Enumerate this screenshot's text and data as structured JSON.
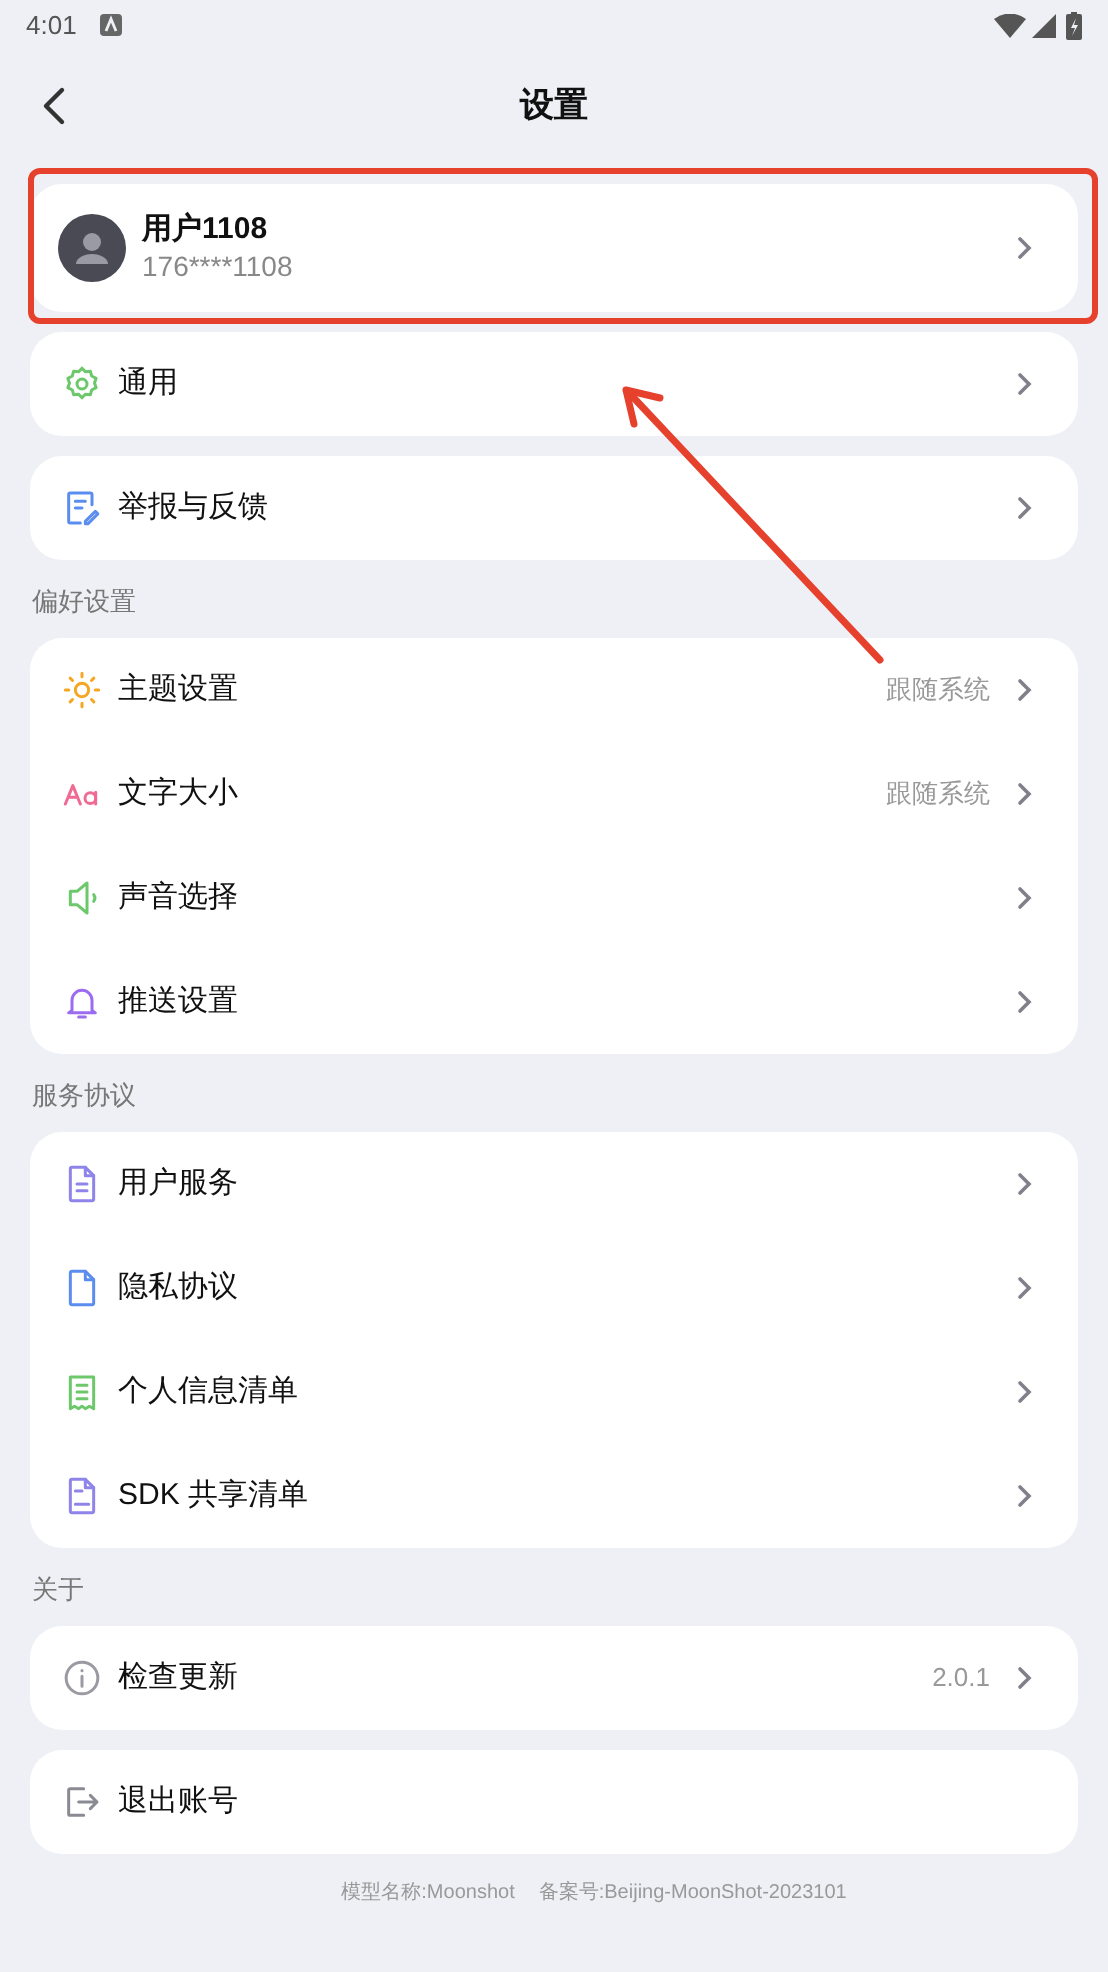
{
  "status_bar": {
    "time": "4:01"
  },
  "header": {
    "title": "设置"
  },
  "profile": {
    "name": "用户1108",
    "phone": "176****1108"
  },
  "groups": [
    {
      "items": [
        {
          "label": "通用"
        }
      ]
    },
    {
      "items": [
        {
          "label": "举报与反馈"
        }
      ]
    },
    {
      "title": "偏好设置",
      "items": [
        {
          "label": "主题设置",
          "value": "跟随系统"
        },
        {
          "label": "文字大小",
          "value": "跟随系统"
        },
        {
          "label": "声音选择"
        },
        {
          "label": "推送设置"
        }
      ]
    },
    {
      "title": "服务协议",
      "items": [
        {
          "label": "用户服务"
        },
        {
          "label": "隐私协议"
        },
        {
          "label": "个人信息清单"
        },
        {
          "label": "SDK 共享清单"
        }
      ]
    },
    {
      "title": "关于",
      "items": [
        {
          "label": "检查更新",
          "value": "2.0.1"
        }
      ]
    },
    {
      "items": [
        {
          "label": "退出账号",
          "chevron": false
        }
      ]
    }
  ],
  "footer": {
    "model": "模型名称:Moonshot",
    "filing": "备案号:Beijing-MoonShot-2023101"
  }
}
